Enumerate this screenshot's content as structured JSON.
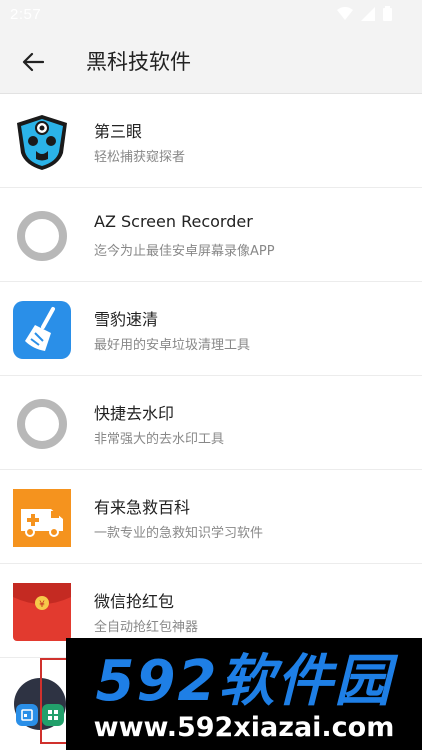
{
  "status_bar": {
    "time": "2:57"
  },
  "app_bar": {
    "title": "黑科技软件"
  },
  "items": [
    {
      "title": "第三眼",
      "subtitle": "轻松捕获窥探者",
      "icon": "third-eye-shield-icon"
    },
    {
      "title": "AZ Screen Recorder",
      "subtitle": "迄今为止最佳安卓屏幕录像APP",
      "icon": "placeholder-ring-icon"
    },
    {
      "title": "雪豹速清",
      "subtitle": "最好用的安卓垃圾清理工具",
      "icon": "broom-cleaner-icon"
    },
    {
      "title": "快捷去水印",
      "subtitle": "非常强大的去水印工具",
      "icon": "placeholder-ring-icon"
    },
    {
      "title": "有来急救百科",
      "subtitle": "一款专业的急救知识学习软件",
      "icon": "ambulance-icon"
    },
    {
      "title": "微信抢红包",
      "subtitle": "全自动抢红包神器",
      "icon": "red-envelope-icon"
    }
  ],
  "watermark": {
    "logo": "592软件园",
    "url": "www.592xiazai.com"
  },
  "colors": {
    "accent_blue": "#2a8fe8",
    "orange": "#f5931e",
    "red": "#e23a2f",
    "wm_blue": "#1e7fe6"
  }
}
